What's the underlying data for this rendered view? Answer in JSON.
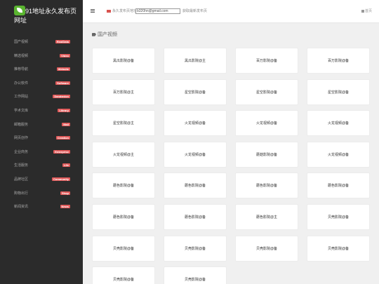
{
  "brand": {
    "title": "91地址永久发布页网址"
  },
  "sidebar": {
    "items": [
      {
        "label": "国产视频",
        "badge": "RealData"
      },
      {
        "label": "精选视频",
        "badge": "Video"
      },
      {
        "label": "推荐导航",
        "badge": "Website"
      },
      {
        "label": "办公软件",
        "badge": "Software"
      },
      {
        "label": "工作网站",
        "badge": "Dandanion"
      },
      {
        "label": "学术文库",
        "badge": "Library"
      },
      {
        "label": "邮箱服务",
        "badge": "Mail"
      },
      {
        "label": "网页创作",
        "badge": "Creation"
      },
      {
        "label": "企业商务",
        "badge": "Enterprise"
      },
      {
        "label": "生活服务",
        "badge": "Life"
      },
      {
        "label": "品牌社区",
        "badge": "Community"
      },
      {
        "label": "购物出行",
        "badge": "Shop"
      },
      {
        "label": "新闻资讯",
        "badge": "News"
      }
    ]
  },
  "topbar": {
    "notice_prefix": "永久发布页地址",
    "email": "b320hn@gmail.com",
    "notice_suffix": "获取最新发布页",
    "home": "首页"
  },
  "section": {
    "title": "国产视频"
  },
  "cards": [
    "黑瓜影院@备",
    "黑瓜影院@主",
    "百万影院@备",
    "百万影院@备",
    "百万影院@主",
    "星空影院@备",
    "星空影院@备",
    "星空影院@备",
    "星空影院@主",
    "火龙视频@备",
    "火龙视频@备",
    "火龙视频@备",
    "火龙视频@主",
    "火龙视频@备",
    "蘑菇影院@备",
    "火龙视频@备",
    "蘑色影院@备",
    "蘑色影院@备",
    "蘑色影院@备",
    "蘑色影院@备",
    "蘑色影院@备",
    "蘑色影院@备",
    "蘑色影院@主",
    "贝壳影院@备",
    "贝壳影院@备",
    "贝壳影院@备",
    "贝壳影院@备",
    "贝壳影院@备",
    "贝壳影院@备",
    "贝壳影院@备"
  ]
}
